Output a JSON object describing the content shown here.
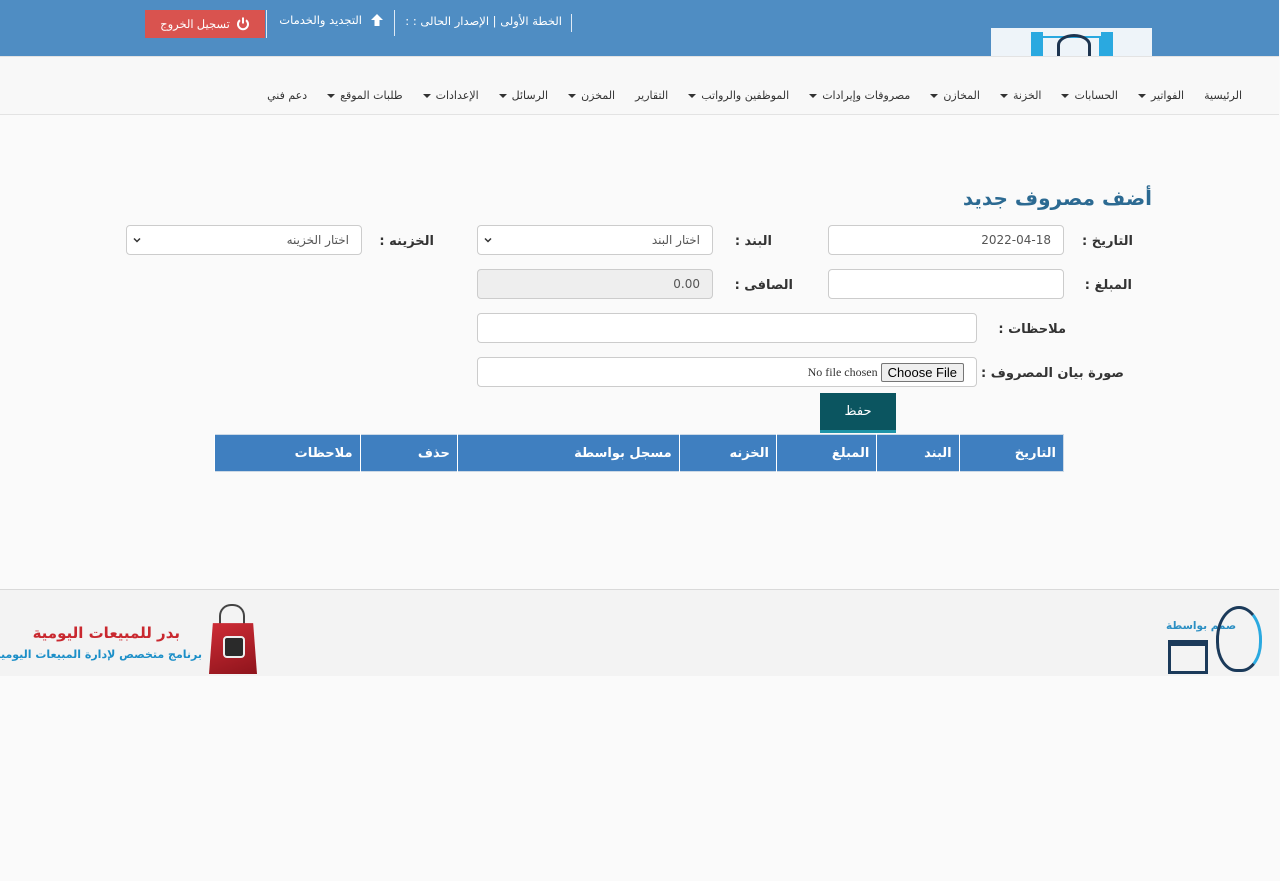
{
  "header": {
    "plan_text": "الخطة الأولى | الإصدار الحالى : :",
    "renew_label": "التجديد والخدمات",
    "logout_label": "تسجيل الخروج",
    "color": "#4f8dc3",
    "logout_color": "#d9534f"
  },
  "nav": {
    "items": [
      {
        "label": "الرئيسية",
        "dropdown": false
      },
      {
        "label": "الفواتير",
        "dropdown": true
      },
      {
        "label": "الحسابات",
        "dropdown": true
      },
      {
        "label": "الخزنة",
        "dropdown": true
      },
      {
        "label": "المخازن",
        "dropdown": true
      },
      {
        "label": "مصروفات وإيرادات",
        "dropdown": true
      },
      {
        "label": "الموظفين والرواتب",
        "dropdown": true
      },
      {
        "label": "التقارير",
        "dropdown": false
      },
      {
        "label": "المخزن",
        "dropdown": true
      },
      {
        "label": "الرسائل",
        "dropdown": true
      },
      {
        "label": "الإعدادات",
        "dropdown": true
      },
      {
        "label": "طلبات الموقع",
        "dropdown": true
      },
      {
        "label": "دعم فني",
        "dropdown": false
      }
    ]
  },
  "form": {
    "title": "أضف مصروف جديد",
    "date_label": "التاريخ :",
    "date_value": "2022-04-18",
    "item_label": "البند :",
    "item_selected": "اختار البند",
    "treasury_label": "الخزينه :",
    "treasury_selected": "اختار الخزينه",
    "amount_label": "المبلغ :",
    "amount_value": "",
    "net_label": "الصافى :",
    "net_value": "0.00",
    "notes_label": "ملاحظات :",
    "notes_value": "",
    "image_label": "صورة بيان المصروف :",
    "file_button": "Choose File",
    "file_status": "No file chosen",
    "save_label": "حفظ"
  },
  "table": {
    "columns": [
      "التاريخ",
      "البند",
      "المبلغ",
      "الخزنه",
      "مسجل بواسطة",
      "حذف",
      "ملاحظات"
    ]
  },
  "footer": {
    "brand_title": "بدر للمبيعات اليومية",
    "brand_subtitle": "برنامج متخصص لإدارة المبيعات اليومية",
    "designed_by": "صمم بواسطة"
  }
}
